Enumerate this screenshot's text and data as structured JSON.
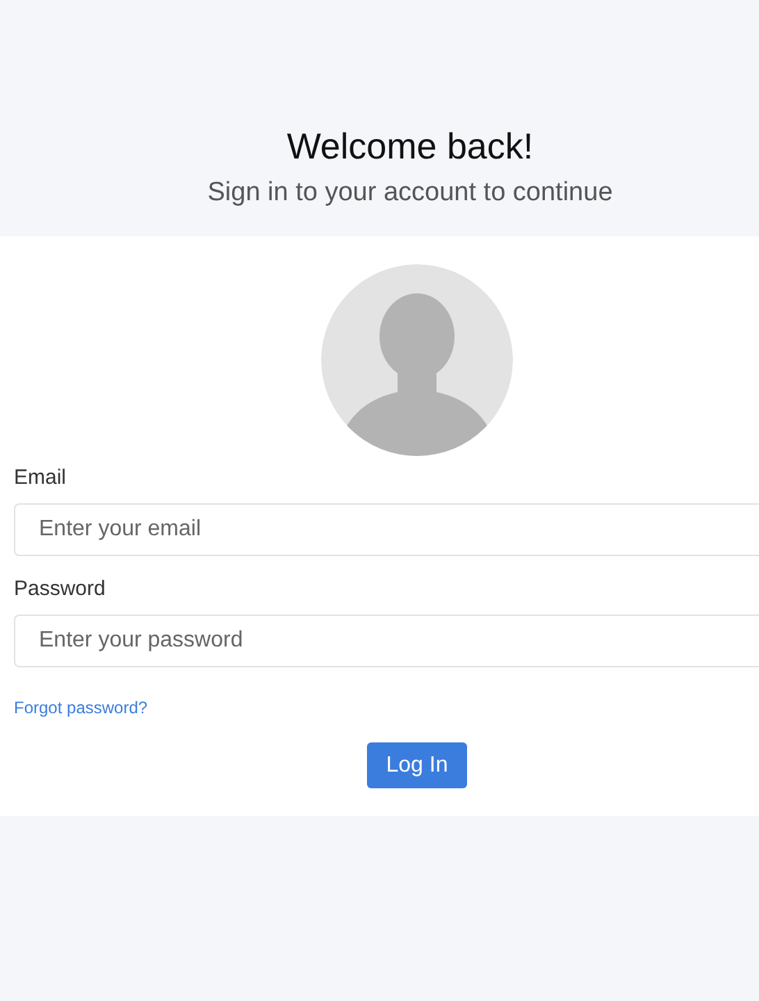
{
  "heading": {
    "title": "Welcome back!",
    "subtitle": "Sign in to your account to continue"
  },
  "form": {
    "avatar": {
      "kind": "silhouette"
    },
    "fields": [
      {
        "label": "Email",
        "placeholder": "Enter your email"
      },
      {
        "label": "Password",
        "placeholder": "Enter your password"
      }
    ],
    "forgot_link": "Forgot password?",
    "submit": "Log In"
  }
}
